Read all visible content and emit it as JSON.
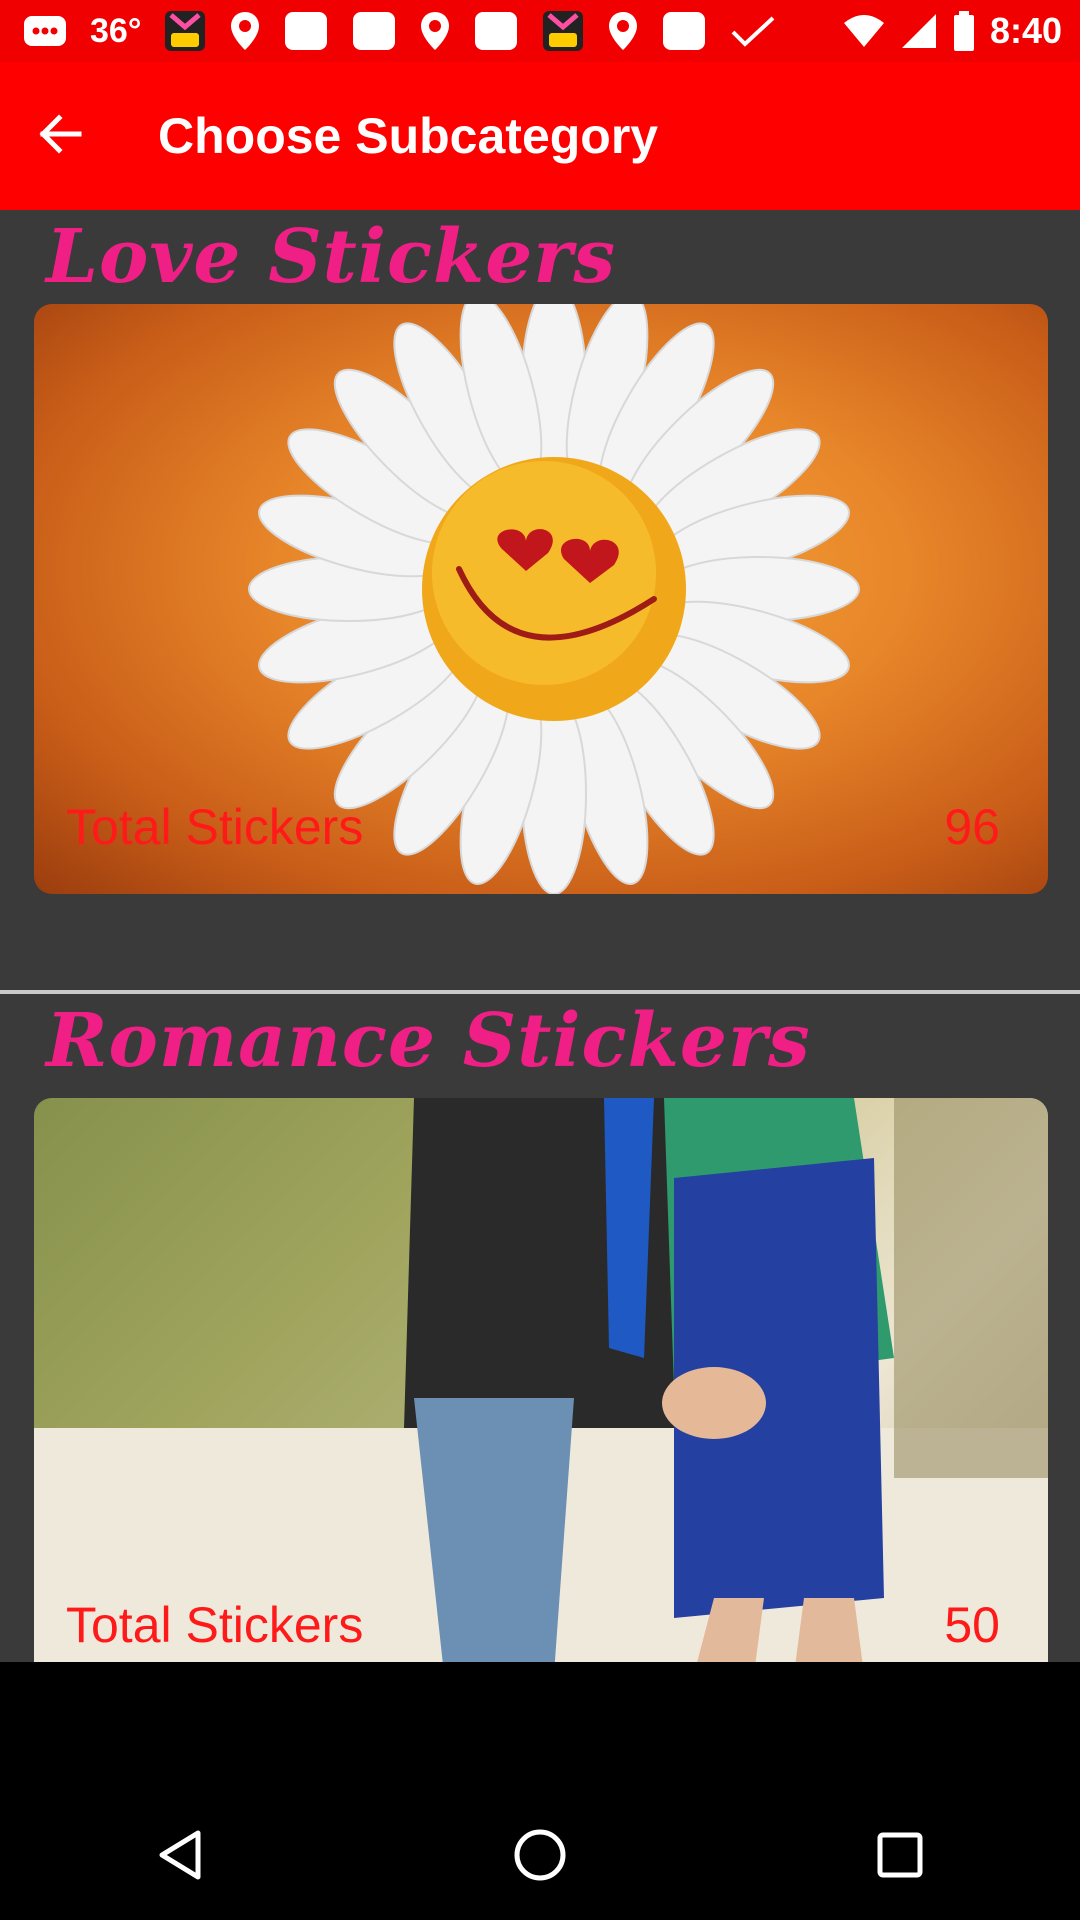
{
  "status_bar": {
    "temperature": "36°",
    "time": "8:40",
    "icons": [
      "messages-icon",
      "pop-app-icon",
      "location-icon",
      "app-square-icon",
      "app-square-icon",
      "location-icon",
      "app-square-icon",
      "pop-app-icon",
      "location-icon",
      "app-square-icon",
      "check-icon"
    ]
  },
  "app_bar": {
    "title": "Choose Subcategory",
    "back_icon": "arrow-back-icon"
  },
  "categories": [
    {
      "title": "Love Stickers",
      "label": "Total Stickers",
      "count": "96",
      "image": "smiling-daisy-image"
    },
    {
      "title": "Romance Stickers",
      "label": "Total Stickers",
      "count": "50",
      "image": "couple-holding-hands-image"
    }
  ],
  "nav_bar": {
    "icons": [
      "back-triangle-icon",
      "home-circle-icon",
      "recents-square-icon"
    ]
  },
  "colors": {
    "accent": "#ff0000",
    "title_pink": "#ef1f86",
    "count_red": "#ff1a1a",
    "panel_bg": "#3a3a3a"
  }
}
